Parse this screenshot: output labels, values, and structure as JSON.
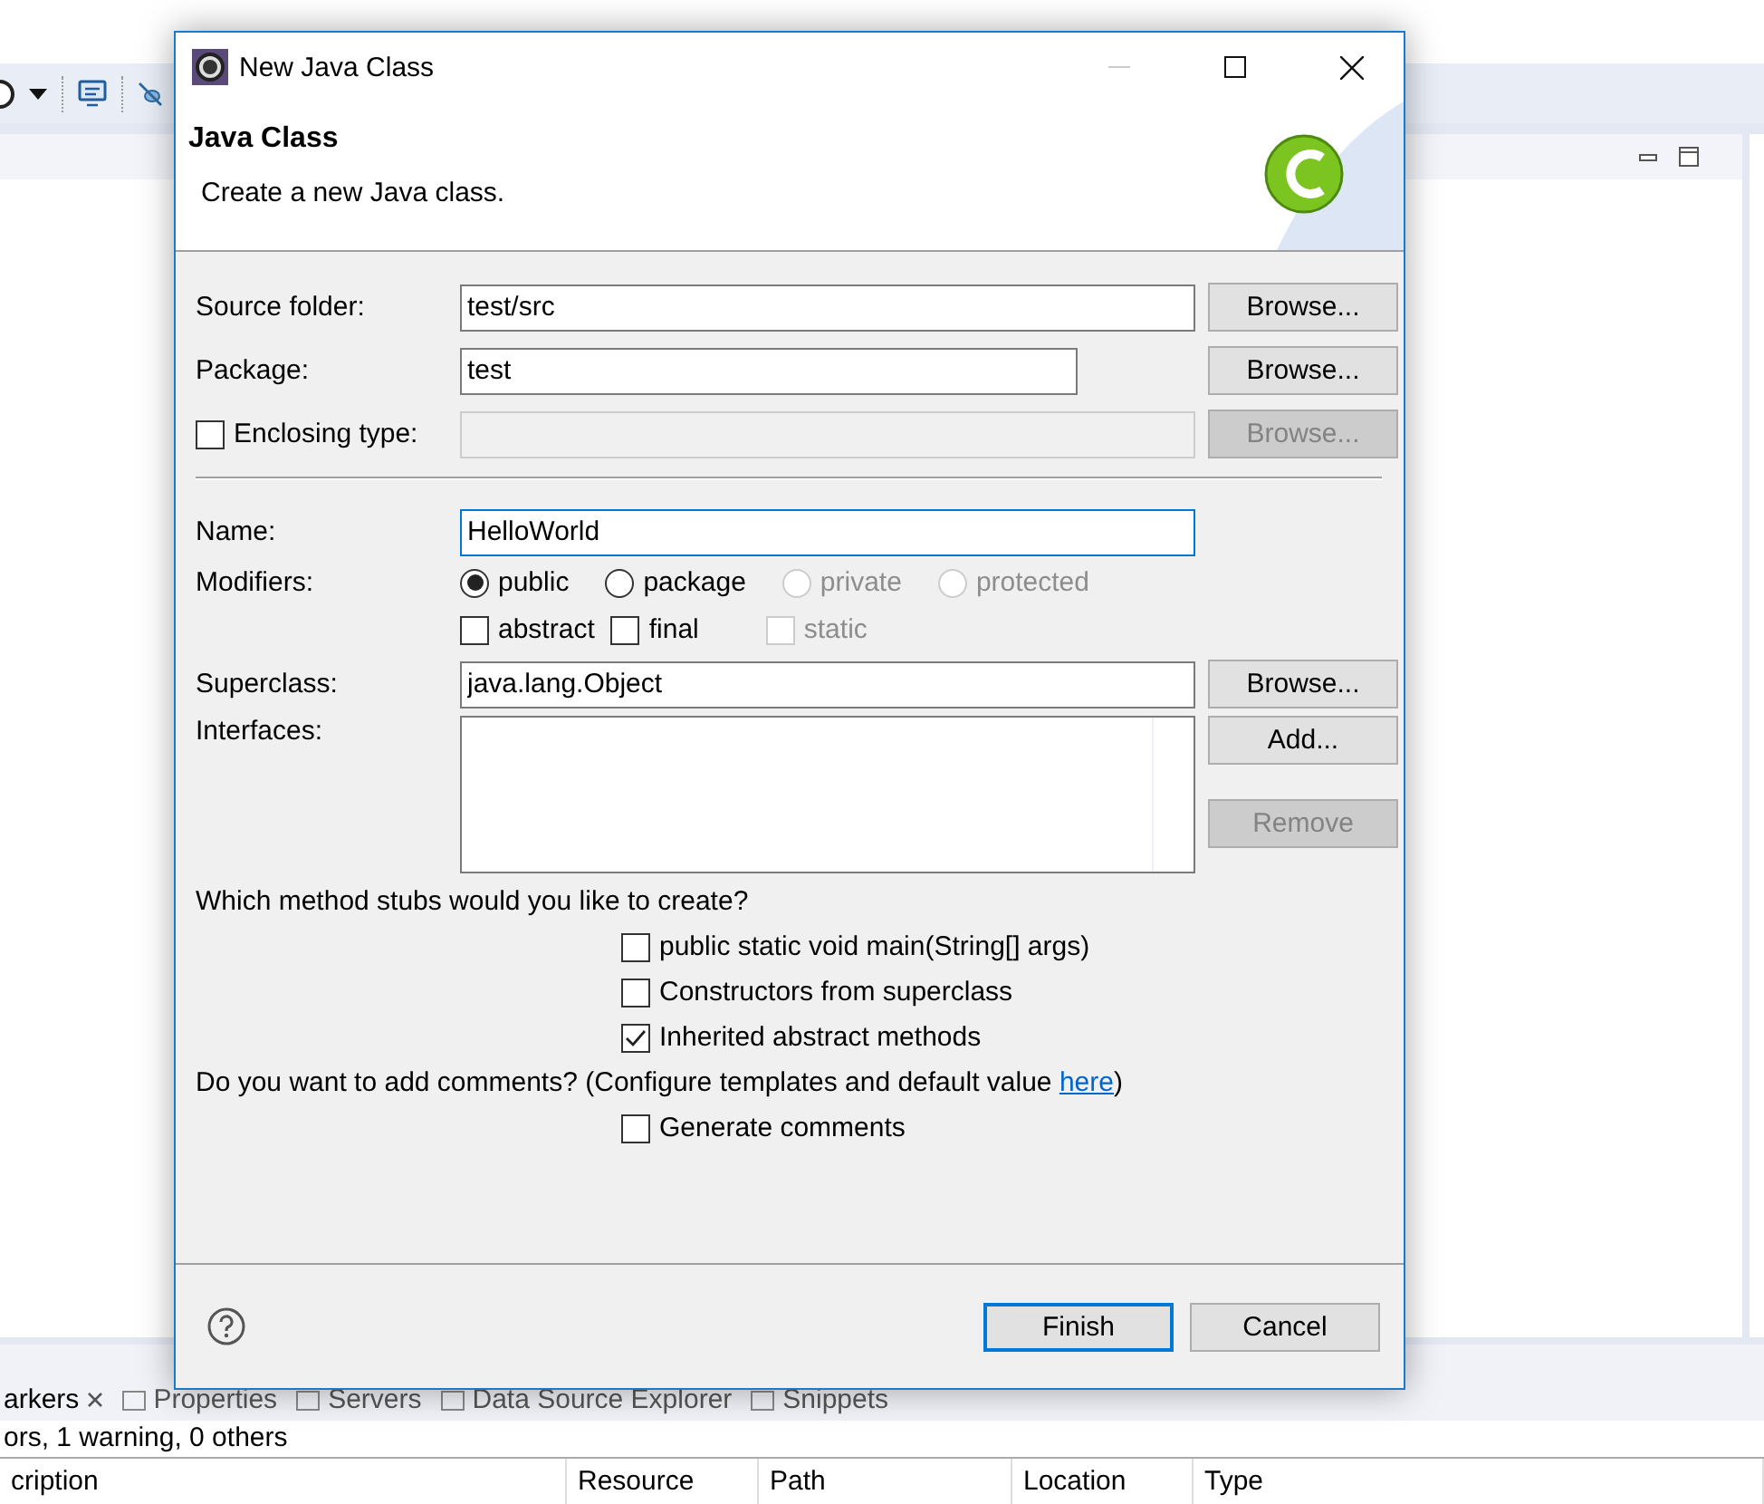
{
  "ide": {
    "bottom_tabs": [
      {
        "label": "arkers",
        "selected": true
      },
      {
        "label": "Properties",
        "selected": false
      },
      {
        "label": "Servers",
        "selected": false
      },
      {
        "label": "Data Source Explorer",
        "selected": false
      },
      {
        "label": "Snippets",
        "selected": false
      }
    ],
    "status": "ors, 1 warning, 0 others",
    "columns": [
      "cription",
      "Resource",
      "Path",
      "Location",
      "Type"
    ]
  },
  "dialog": {
    "title": "New Java Class",
    "heading": "Java Class",
    "description": "Create a new Java class.",
    "source_folder": {
      "label": "Source folder:",
      "value": "test/src",
      "button": "Browse..."
    },
    "package": {
      "label": "Package:",
      "value": "test",
      "button": "Browse..."
    },
    "enclosing_type": {
      "label": "Enclosing type:",
      "checked": false,
      "button": "Browse...",
      "disabled": true
    },
    "name": {
      "label": "Name:",
      "value": "HelloWorld",
      "focused": true
    },
    "modifiers": {
      "label": "Modifiers:",
      "options": [
        {
          "label": "public",
          "selected": true,
          "disabled": false
        },
        {
          "label": "package",
          "selected": false,
          "disabled": false
        },
        {
          "label": "private",
          "selected": false,
          "disabled": true
        },
        {
          "label": "protected",
          "selected": false,
          "disabled": true
        }
      ],
      "flags": [
        {
          "label": "abstract",
          "checked": false,
          "disabled": false
        },
        {
          "label": "final",
          "checked": false,
          "disabled": false
        },
        {
          "label": "static",
          "checked": false,
          "disabled": true
        }
      ]
    },
    "superclass": {
      "label": "Superclass:",
      "value": "java.lang.Object",
      "button": "Browse..."
    },
    "interfaces": {
      "label": "Interfaces:",
      "buttons": [
        {
          "label": "Add...",
          "disabled": false
        },
        {
          "label": "Remove",
          "disabled": true
        }
      ]
    },
    "stubs": {
      "question": "Which method stubs would you like to create?",
      "options": [
        {
          "label": "public static void main(String[] args)",
          "checked": false
        },
        {
          "label": "Constructors from superclass",
          "checked": false
        },
        {
          "label": "Inherited abstract methods",
          "checked": true
        }
      ]
    },
    "comments": {
      "question": "Do you want to add comments? (Configure templates and default value",
      "link": "here",
      "after": ")",
      "option": {
        "label": "Generate comments",
        "checked": false
      }
    },
    "buttons": [
      {
        "label": "Finish",
        "default": true
      },
      {
        "label": "Cancel",
        "default": false
      }
    ]
  }
}
